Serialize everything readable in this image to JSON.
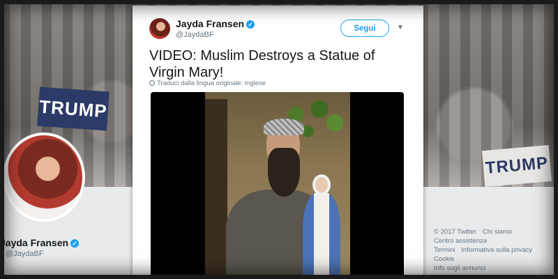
{
  "background": {
    "sign_left": "TRUMP",
    "sign_right": "TRUMP",
    "profile": {
      "name": "Jayda Fransen",
      "handle": "@JaydaBF"
    },
    "footer_links": [
      "© 2017 Twitter",
      "Chi siamo",
      "Centro assistenza",
      "Termini",
      "Informativa sulla privacy",
      "Cookie",
      "Info sugli annunci"
    ]
  },
  "tweet": {
    "author_name": "Jayda Fransen",
    "author_handle": "@JaydaBF",
    "verified": true,
    "follow_label": "Segui",
    "text": "VIDEO: Muslim Destroys a Statue of Virgin Mary!",
    "translate_label": "Traduci dalla lingua originale: inglese",
    "icons": {
      "verified": "verified-badge-icon",
      "more": "chevron-down-icon",
      "translate": "globe-icon"
    }
  },
  "colors": {
    "accent": "#1da1f2",
    "text_primary": "#14171a",
    "text_secondary": "#657786"
  }
}
